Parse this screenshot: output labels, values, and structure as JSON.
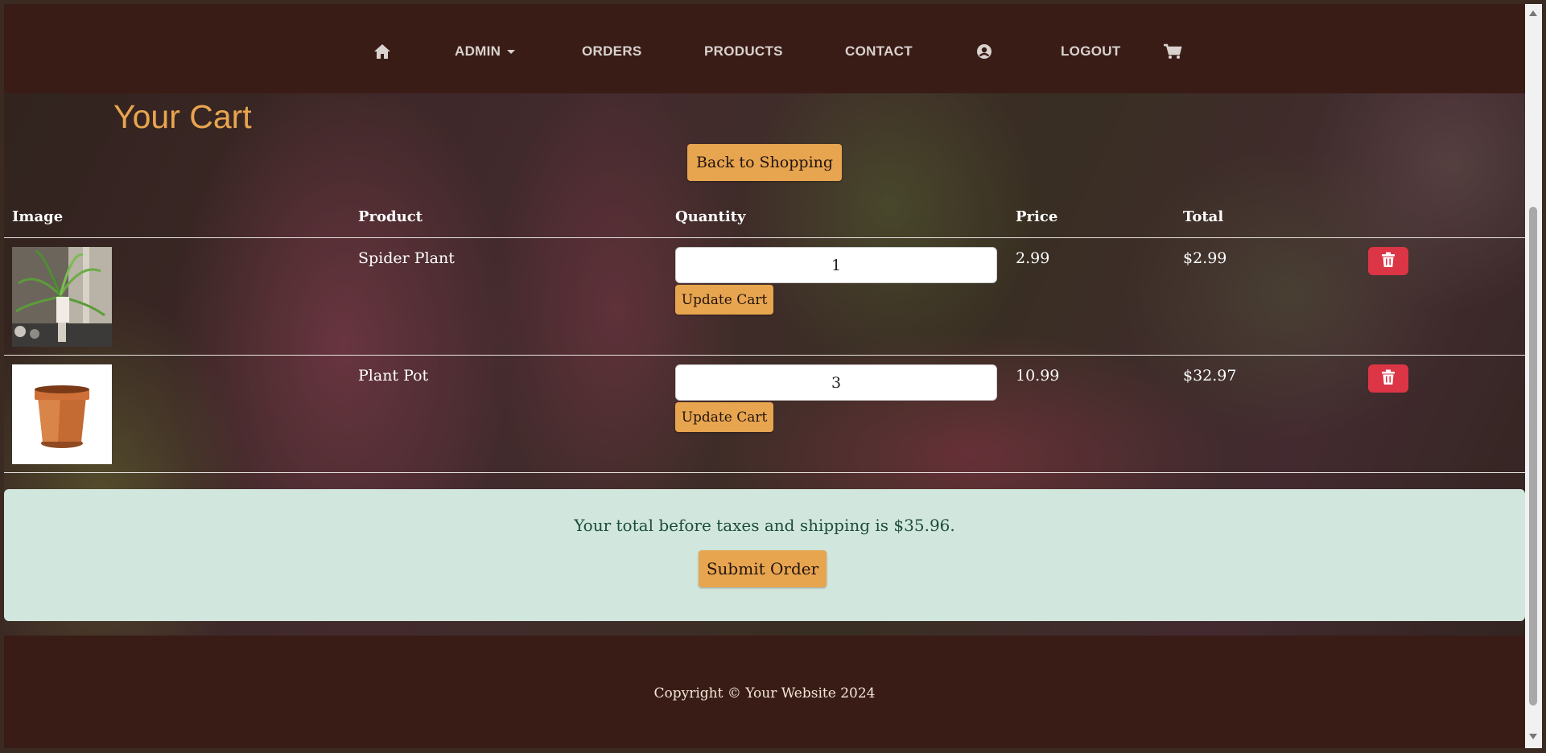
{
  "nav": {
    "admin": "ADMIN",
    "orders": "ORDERS",
    "products": "PRODUCTS",
    "contact": "CONTACT",
    "logout": "LOGOUT",
    "icons": [
      "home-icon",
      "user-circle-icon",
      "shopping-cart-icon",
      "chevron-down-icon"
    ]
  },
  "page": {
    "title": "Your Cart",
    "back_button": "Back to Shopping"
  },
  "table": {
    "headers": [
      "Image",
      "Product",
      "Quantity",
      "Price",
      "Total"
    ],
    "rows": [
      {
        "product": "Spider Plant",
        "quantity": "1",
        "price": "2.99",
        "total": "$2.99",
        "update_label": "Update Cart",
        "image_icon": "spider-plant-image"
      },
      {
        "product": "Plant Pot",
        "quantity": "3",
        "price": "10.99",
        "total": "$32.97",
        "update_label": "Update Cart",
        "image_icon": "plant-pot-image"
      }
    ],
    "delete_icon": "trash-icon"
  },
  "summary": {
    "text": "Your total before taxes and shipping is $35.96.",
    "submit_label": "Submit Order"
  },
  "footer": {
    "text": "Copyright © Your Website 2024"
  },
  "colors": {
    "accent": "#e8a54f",
    "navbar": "#3a1c16",
    "danger": "#dc3545",
    "summary_bg": "#d1e6dd"
  }
}
